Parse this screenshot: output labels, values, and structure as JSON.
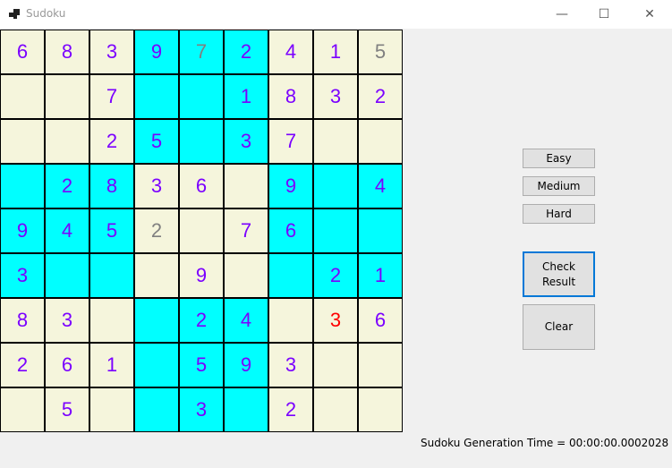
{
  "window": {
    "title": "Sudoku",
    "controls": {
      "minimize": "—",
      "maximize": "☐",
      "close": "✕"
    }
  },
  "board": {
    "colors": {
      "given": "#7b00ff",
      "gray": "#808080",
      "error": "#ff0000",
      "cream": "#f5f5dc",
      "cyan": "#00ffff"
    },
    "cells": [
      [
        {
          "v": "6",
          "c": "given",
          "bg": "cream"
        },
        {
          "v": "8",
          "c": "given",
          "bg": "cream"
        },
        {
          "v": "3",
          "c": "given",
          "bg": "cream"
        },
        {
          "v": "9",
          "c": "given",
          "bg": "cyan"
        },
        {
          "v": "7",
          "c": "gray",
          "bg": "cyan"
        },
        {
          "v": "2",
          "c": "given",
          "bg": "cyan"
        },
        {
          "v": "4",
          "c": "given",
          "bg": "cream"
        },
        {
          "v": "1",
          "c": "given",
          "bg": "cream"
        },
        {
          "v": "5",
          "c": "gray",
          "bg": "cream"
        }
      ],
      [
        {
          "v": "",
          "c": "given",
          "bg": "cream"
        },
        {
          "v": "",
          "c": "given",
          "bg": "cream"
        },
        {
          "v": "7",
          "c": "given",
          "bg": "cream"
        },
        {
          "v": "",
          "c": "given",
          "bg": "cyan"
        },
        {
          "v": "",
          "c": "given",
          "bg": "cyan"
        },
        {
          "v": "1",
          "c": "given",
          "bg": "cyan"
        },
        {
          "v": "8",
          "c": "given",
          "bg": "cream"
        },
        {
          "v": "3",
          "c": "given",
          "bg": "cream"
        },
        {
          "v": "2",
          "c": "given",
          "bg": "cream"
        }
      ],
      [
        {
          "v": "",
          "c": "given",
          "bg": "cream"
        },
        {
          "v": "",
          "c": "given",
          "bg": "cream"
        },
        {
          "v": "2",
          "c": "given",
          "bg": "cream"
        },
        {
          "v": "5",
          "c": "given",
          "bg": "cyan"
        },
        {
          "v": "",
          "c": "given",
          "bg": "cyan"
        },
        {
          "v": "3",
          "c": "given",
          "bg": "cyan"
        },
        {
          "v": "7",
          "c": "given",
          "bg": "cream"
        },
        {
          "v": "",
          "c": "given",
          "bg": "cream"
        },
        {
          "v": "",
          "c": "given",
          "bg": "cream"
        }
      ],
      [
        {
          "v": "",
          "c": "given",
          "bg": "cyan"
        },
        {
          "v": "2",
          "c": "given",
          "bg": "cyan"
        },
        {
          "v": "8",
          "c": "given",
          "bg": "cyan"
        },
        {
          "v": "3",
          "c": "given",
          "bg": "cream"
        },
        {
          "v": "6",
          "c": "given",
          "bg": "cream"
        },
        {
          "v": "",
          "c": "given",
          "bg": "cream"
        },
        {
          "v": "9",
          "c": "given",
          "bg": "cyan"
        },
        {
          "v": "",
          "c": "given",
          "bg": "cyan"
        },
        {
          "v": "4",
          "c": "given",
          "bg": "cyan"
        }
      ],
      [
        {
          "v": "9",
          "c": "given",
          "bg": "cyan"
        },
        {
          "v": "4",
          "c": "given",
          "bg": "cyan"
        },
        {
          "v": "5",
          "c": "given",
          "bg": "cyan"
        },
        {
          "v": "2",
          "c": "gray",
          "bg": "cream"
        },
        {
          "v": "",
          "c": "given",
          "bg": "cream"
        },
        {
          "v": "7",
          "c": "given",
          "bg": "cream"
        },
        {
          "v": "6",
          "c": "given",
          "bg": "cyan"
        },
        {
          "v": "",
          "c": "given",
          "bg": "cyan"
        },
        {
          "v": "",
          "c": "given",
          "bg": "cyan"
        }
      ],
      [
        {
          "v": "3",
          "c": "given",
          "bg": "cyan"
        },
        {
          "v": "",
          "c": "given",
          "bg": "cyan"
        },
        {
          "v": "",
          "c": "given",
          "bg": "cyan"
        },
        {
          "v": "",
          "c": "given",
          "bg": "cream"
        },
        {
          "v": "9",
          "c": "given",
          "bg": "cream"
        },
        {
          "v": "",
          "c": "given",
          "bg": "cream"
        },
        {
          "v": "",
          "c": "given",
          "bg": "cyan"
        },
        {
          "v": "2",
          "c": "given",
          "bg": "cyan"
        },
        {
          "v": "1",
          "c": "given",
          "bg": "cyan"
        }
      ],
      [
        {
          "v": "8",
          "c": "given",
          "bg": "cream"
        },
        {
          "v": "3",
          "c": "given",
          "bg": "cream"
        },
        {
          "v": "",
          "c": "given",
          "bg": "cream"
        },
        {
          "v": "",
          "c": "given",
          "bg": "cyan"
        },
        {
          "v": "2",
          "c": "given",
          "bg": "cyan"
        },
        {
          "v": "4",
          "c": "given",
          "bg": "cyan"
        },
        {
          "v": "",
          "c": "given",
          "bg": "cream"
        },
        {
          "v": "3",
          "c": "error",
          "bg": "cream"
        },
        {
          "v": "6",
          "c": "given",
          "bg": "cream"
        }
      ],
      [
        {
          "v": "2",
          "c": "given",
          "bg": "cream"
        },
        {
          "v": "6",
          "c": "given",
          "bg": "cream"
        },
        {
          "v": "1",
          "c": "given",
          "bg": "cream"
        },
        {
          "v": "",
          "c": "given",
          "bg": "cyan"
        },
        {
          "v": "5",
          "c": "given",
          "bg": "cyan"
        },
        {
          "v": "9",
          "c": "given",
          "bg": "cyan"
        },
        {
          "v": "3",
          "c": "given",
          "bg": "cream"
        },
        {
          "v": "",
          "c": "given",
          "bg": "cream"
        },
        {
          "v": "",
          "c": "given",
          "bg": "cream"
        }
      ],
      [
        {
          "v": "",
          "c": "given",
          "bg": "cream"
        },
        {
          "v": "5",
          "c": "given",
          "bg": "cream"
        },
        {
          "v": "",
          "c": "given",
          "bg": "cream"
        },
        {
          "v": "",
          "c": "given",
          "bg": "cyan"
        },
        {
          "v": "3",
          "c": "given",
          "bg": "cyan"
        },
        {
          "v": "",
          "c": "given",
          "bg": "cyan"
        },
        {
          "v": "2",
          "c": "given",
          "bg": "cream"
        },
        {
          "v": "",
          "c": "given",
          "bg": "cream"
        },
        {
          "v": "",
          "c": "given",
          "bg": "cream"
        }
      ]
    ]
  },
  "buttons": {
    "easy": "Easy",
    "medium": "Medium",
    "hard": "Hard",
    "check_line1": "Check",
    "check_line2": "Result",
    "clear": "Clear"
  },
  "status": {
    "generation_time": "Sudoku Generation Time = 00:00:00.0002028"
  }
}
